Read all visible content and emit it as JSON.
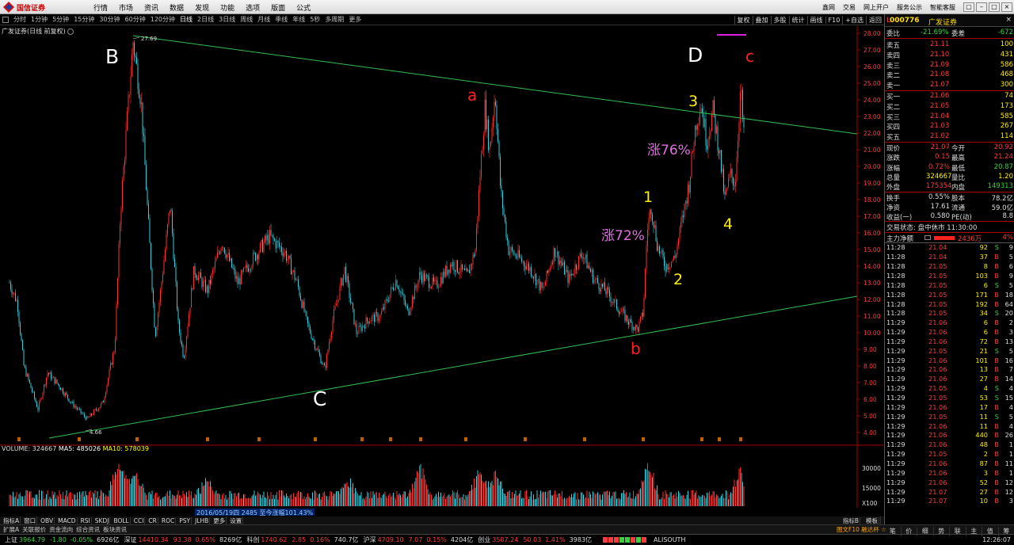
{
  "app": {
    "logo_text": "国信证券",
    "menu": [
      "行情",
      "市场",
      "资讯",
      "数据",
      "发现",
      "功能",
      "选项",
      "版面",
      "公式"
    ],
    "top_links": [
      "鑫网",
      "交易",
      "网上开户",
      "服务公示",
      "智能客服"
    ]
  },
  "periods": {
    "items": [
      "分时",
      "1分钟",
      "5分钟",
      "15分钟",
      "30分钟",
      "60分钟",
      "120分钟",
      "日线",
      "2日线",
      "3日线",
      "周线",
      "月线",
      "季线",
      "年线",
      "5秒",
      "多周期",
      "更多"
    ],
    "active": "日线",
    "tools": [
      "复权",
      "叠加",
      "多股",
      "统计",
      "画线",
      "F10",
      "+自选",
      "返回"
    ]
  },
  "chart": {
    "title": "广发证券(日线 前复权)",
    "price_axis": [
      "28.00",
      "27.00",
      "26.00",
      "25.00",
      "24.00",
      "23.00",
      "22.00",
      "21.00",
      "20.00",
      "19.00",
      "18.00",
      "17.00",
      "16.00",
      "15.00",
      "14.00",
      "13.00",
      "12.00",
      "11.00",
      "10.00",
      "9.00",
      "8.00",
      "7.00",
      "6.00",
      "5.00",
      "4.00"
    ],
    "high_label": "27.69",
    "low_label": "4.66",
    "annotations": [
      {
        "text": "B",
        "color": "#ffffff"
      },
      {
        "text": "C",
        "color": "#ffffff"
      },
      {
        "text": "D",
        "color": "#ffffff"
      },
      {
        "text": "a",
        "color": "#ff2020"
      },
      {
        "text": "b",
        "color": "#ff2020"
      },
      {
        "text": "c",
        "color": "#ff2020"
      },
      {
        "text": "1",
        "color": "#ffee00"
      },
      {
        "text": "2",
        "color": "#ffee00"
      },
      {
        "text": "3",
        "color": "#ffee00"
      },
      {
        "text": "4",
        "color": "#ffee00"
      },
      {
        "text": "涨72%",
        "color": "#e070e0"
      },
      {
        "text": "涨76%",
        "color": "#e070e0"
      }
    ]
  },
  "volume": {
    "label": "VOLUME: 324667",
    "ma5": "MA5: 485026",
    "ma10": "MA10: 578039",
    "axis": [
      "30000",
      "15000",
      "X100"
    ],
    "date_overlay": "2016/05/19四 2485 至今涨幅101.43%",
    "x_axis": [
      "2012年",
      "5",
      "8",
      "11",
      "2",
      "4",
      "7",
      "10",
      "1",
      "4",
      "7",
      "10",
      "1",
      "4",
      "7",
      "10",
      "1",
      "4",
      "7",
      "10"
    ],
    "date_label": "日线"
  },
  "indicators": {
    "tabs": [
      "指标A",
      "窗口",
      "OBV",
      "MACD",
      "RSI",
      "SKDJ",
      "BOLL",
      "CCI",
      "CR",
      "ROC",
      "PSY",
      "JLHB",
      "更多",
      "设置"
    ],
    "right_tabs": [
      "指标B",
      "模板"
    ]
  },
  "bottom_links": [
    "扩展A",
    "关联报价",
    "资金流向",
    "综合资讯",
    "板块资讯"
  ],
  "bottom_right": "图文F10 融达杯 ☆",
  "status": {
    "indices": [
      {
        "name": "上证",
        "value": "3964.79",
        "chg": "-1.80",
        "pct": "-0.05%",
        "amt": "6926亿",
        "dir": "dn"
      },
      {
        "name": "深证",
        "value": "14410.34",
        "chg": "93.38",
        "pct": "0.65%",
        "amt": "8269亿",
        "dir": "up"
      },
      {
        "name": "科创",
        "value": "1740.62",
        "chg": "2.85",
        "pct": "0.16%",
        "amt": "740.7亿",
        "dir": "up"
      },
      {
        "name": "沪深",
        "value": "4709.10",
        "chg": "7.07",
        "pct": "0.15%",
        "amt": "4204亿",
        "dir": "up"
      },
      {
        "name": "创业",
        "value": "3587.24",
        "chg": "50.03",
        "pct": "1.41%",
        "amt": "3983亿",
        "dir": "up"
      }
    ],
    "server": "ALISOUTH",
    "time": "12:26:07"
  },
  "quote": {
    "code": "000776",
    "name": "广发证券",
    "wei_bi": {
      "label": "委比",
      "value": "-21.69%",
      "label2": "委差",
      "value2": "-672"
    },
    "asks": [
      {
        "label": "卖五",
        "price": "21.11",
        "vol": "100"
      },
      {
        "label": "卖四",
        "price": "21.10",
        "vol": "431"
      },
      {
        "label": "卖三",
        "price": "21.09",
        "vol": "586"
      },
      {
        "label": "卖二",
        "price": "21.08",
        "vol": "468"
      },
      {
        "label": "卖一",
        "price": "21.07",
        "vol": "300"
      }
    ],
    "bids": [
      {
        "label": "买一",
        "price": "21.06",
        "vol": "74"
      },
      {
        "label": "买二",
        "price": "21.05",
        "vol": "173"
      },
      {
        "label": "买三",
        "price": "21.04",
        "vol": "585"
      },
      {
        "label": "买四",
        "price": "21.03",
        "vol": "267"
      },
      {
        "label": "买五",
        "price": "21.02",
        "vol": "114"
      }
    ],
    "stats": [
      {
        "l1": "现价",
        "v1": "21.07",
        "c1": "#ff3b3b",
        "l2": "今开",
        "v2": "20.92",
        "c2": "#ff3b3b"
      },
      {
        "l1": "涨跌",
        "v1": "0.15",
        "c1": "#ff3b3b",
        "l2": "最高",
        "v2": "21.24",
        "c2": "#ff3b3b"
      },
      {
        "l1": "涨幅",
        "v1": "0.72%",
        "c1": "#ff3b3b",
        "l2": "最低",
        "v2": "20.87",
        "c2": "#3bd23b"
      },
      {
        "l1": "总量",
        "v1": "324667",
        "c1": "#ffee00",
        "l2": "量比",
        "v2": "1.20",
        "c2": "#ffee00"
      },
      {
        "l1": "外盘",
        "v1": "175354",
        "c1": "#ff3b3b",
        "l2": "内盘",
        "v2": "149313",
        "c2": "#3bd23b"
      },
      {
        "l1": "换手",
        "v1": "0.55%",
        "c1": "#dddddd",
        "l2": "股本",
        "v2": "78.2亿",
        "c2": "#dddddd"
      },
      {
        "l1": "净资",
        "v1": "17.61",
        "c1": "#dddddd",
        "l2": "流通",
        "v2": "59.0亿",
        "c2": "#dddddd"
      },
      {
        "l1": "收益(一)",
        "v1": "0.580",
        "c1": "#dddddd",
        "l2": "PE(动)",
        "v2": "8.8",
        "c2": "#dddddd"
      }
    ],
    "trade_status": "交易状态: 盘中休市 11:30:00",
    "main_flow": {
      "label": "主力净额",
      "value": "2436万",
      "pct": "4%"
    },
    "ticks": [
      {
        "t": "11:28",
        "p": "21.04",
        "v": "92",
        "s": "S",
        "n": "9"
      },
      {
        "t": "11:28",
        "p": "21.04",
        "v": "37",
        "s": "B",
        "n": "5"
      },
      {
        "t": "11:28",
        "p": "21.05",
        "v": "8",
        "s": "B",
        "n": "6"
      },
      {
        "t": "11:28",
        "p": "21.05",
        "v": "103",
        "s": "B",
        "n": "9"
      },
      {
        "t": "11:28",
        "p": "21.05",
        "v": "6",
        "s": "S",
        "n": "5"
      },
      {
        "t": "11:28",
        "p": "21.05",
        "v": "171",
        "s": "B",
        "n": "18"
      },
      {
        "t": "11:28",
        "p": "21.05",
        "v": "192",
        "s": "B",
        "n": "64"
      },
      {
        "t": "11:28",
        "p": "21.05",
        "v": "34",
        "s": "S",
        "n": "20"
      },
      {
        "t": "11:29",
        "p": "21.06",
        "v": "6",
        "s": "B",
        "n": "2"
      },
      {
        "t": "11:29",
        "p": "21.06",
        "v": "6",
        "s": "B",
        "n": "3"
      },
      {
        "t": "11:29",
        "p": "21.06",
        "v": "72",
        "s": "B",
        "n": "13"
      },
      {
        "t": "11:29",
        "p": "21.05",
        "v": "21",
        "s": "S",
        "n": "5"
      },
      {
        "t": "11:29",
        "p": "21.06",
        "v": "101",
        "s": "B",
        "n": "16"
      },
      {
        "t": "11:29",
        "p": "21.06",
        "v": "13",
        "s": "B",
        "n": "7"
      },
      {
        "t": "11:29",
        "p": "21.06",
        "v": "27",
        "s": "B",
        "n": "14"
      },
      {
        "t": "11:29",
        "p": "21.05",
        "v": "4",
        "s": "S",
        "n": "4"
      },
      {
        "t": "11:29",
        "p": "21.05",
        "v": "53",
        "s": "S",
        "n": "15"
      },
      {
        "t": "11:29",
        "p": "21.06",
        "v": "17",
        "s": "B",
        "n": "4"
      },
      {
        "t": "11:29",
        "p": "21.05",
        "v": "11",
        "s": "S",
        "n": "5"
      },
      {
        "t": "11:29",
        "p": "21.06",
        "v": "11",
        "s": "B",
        "n": "4"
      },
      {
        "t": "11:29",
        "p": "21.06",
        "v": "440",
        "s": "B",
        "n": "26"
      },
      {
        "t": "11:29",
        "p": "21.06",
        "v": "48",
        "s": "B",
        "n": "1"
      },
      {
        "t": "11:29",
        "p": "21.05",
        "v": "2",
        "s": "B",
        "n": "1"
      },
      {
        "t": "11:29",
        "p": "21.06",
        "v": "87",
        "s": "B",
        "n": "11"
      },
      {
        "t": "11:29",
        "p": "21.06",
        "v": "3",
        "s": "B",
        "n": "1"
      },
      {
        "t": "11:29",
        "p": "21.06",
        "v": "52",
        "s": "B",
        "n": "12"
      },
      {
        "t": "11:29",
        "p": "21.07",
        "v": "27",
        "s": "B",
        "n": "12"
      },
      {
        "t": "11:29",
        "p": "21.07",
        "v": "10",
        "s": "B",
        "n": "3"
      }
    ],
    "bottom_tabs": [
      "笔",
      "价",
      "细",
      "势",
      "联",
      "主",
      "值",
      "筹"
    ]
  }
}
